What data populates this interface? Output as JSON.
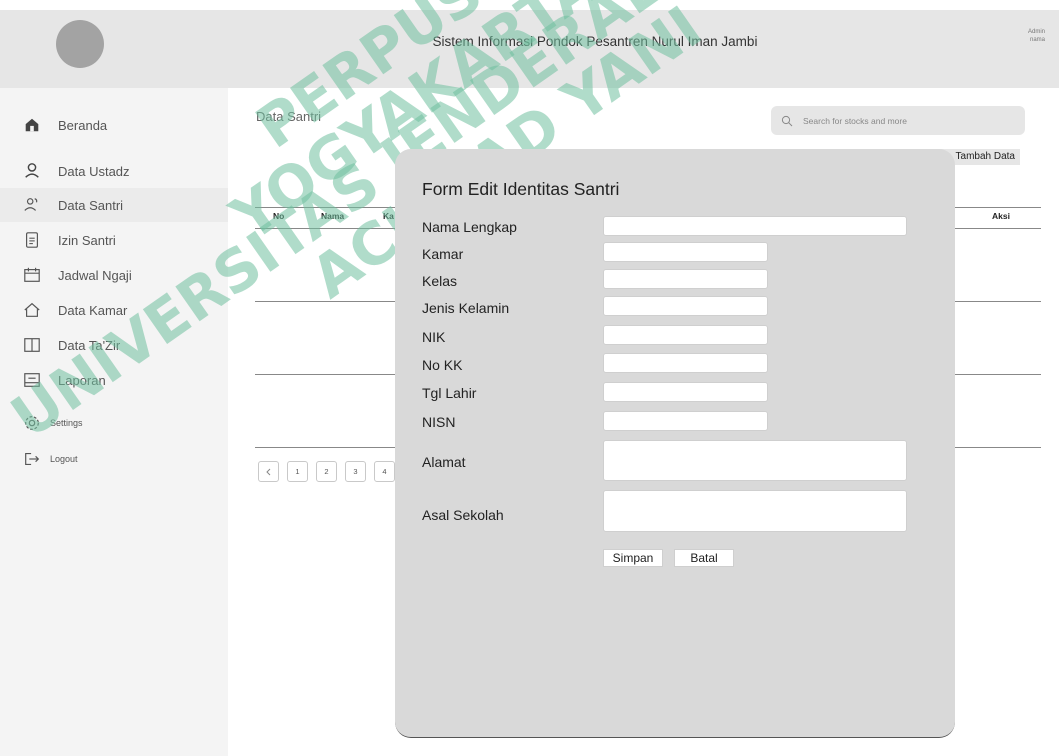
{
  "header": {
    "title": "Sistem Informasi Pondok Pesantren Nurul Iman Jambi",
    "admin_label": "Admin",
    "admin_name": "nama"
  },
  "sidebar": {
    "items": [
      {
        "label": "Beranda",
        "icon": "home-icon"
      },
      {
        "label": "Data Ustadz",
        "icon": "user-icon"
      },
      {
        "label": "Data Santri",
        "icon": "users-icon"
      },
      {
        "label": "Izin Santri",
        "icon": "document-icon"
      },
      {
        "label": "Jadwal Ngaji",
        "icon": "calendar-icon"
      },
      {
        "label": "Data Kamar",
        "icon": "house-outline-icon"
      },
      {
        "label": "Data Ta'Zir",
        "icon": "book-icon"
      },
      {
        "label": "Laporan",
        "icon": "report-icon"
      },
      {
        "label": "Settings",
        "icon": "gear-icon"
      },
      {
        "label": "Logout",
        "icon": "logout-icon"
      }
    ]
  },
  "main": {
    "title": "Data Santri",
    "search_placeholder": "Search for stocks and more",
    "add_button": "Tambah Data",
    "columns": [
      "No",
      "Nama",
      "Ka",
      "Aksi"
    ],
    "pages": [
      "1",
      "2",
      "3",
      "4"
    ]
  },
  "watermark": {
    "text": "UNIVERSITAS JENDERAL ACHMAD YANI YOGYAKARTA",
    "line1": "PERPUSTAKAAN",
    "line2": "UNIVERSITAS JENDERAL",
    "line3": "ACHMAD YANI",
    "line4": "YOGYAKARTA"
  },
  "modal": {
    "title": "Form Edit Identitas Santri",
    "fields": [
      {
        "label": "Nama Lengkap"
      },
      {
        "label": "Kamar"
      },
      {
        "label": "Kelas"
      },
      {
        "label": "Jenis Kelamin"
      },
      {
        "label": "NIK"
      },
      {
        "label": "No KK"
      },
      {
        "label": "Tgl Lahir"
      },
      {
        "label": "NISN"
      },
      {
        "label": "Alamat"
      },
      {
        "label": "Asal Sekolah"
      }
    ],
    "save_label": "Simpan",
    "cancel_label": "Batal"
  }
}
